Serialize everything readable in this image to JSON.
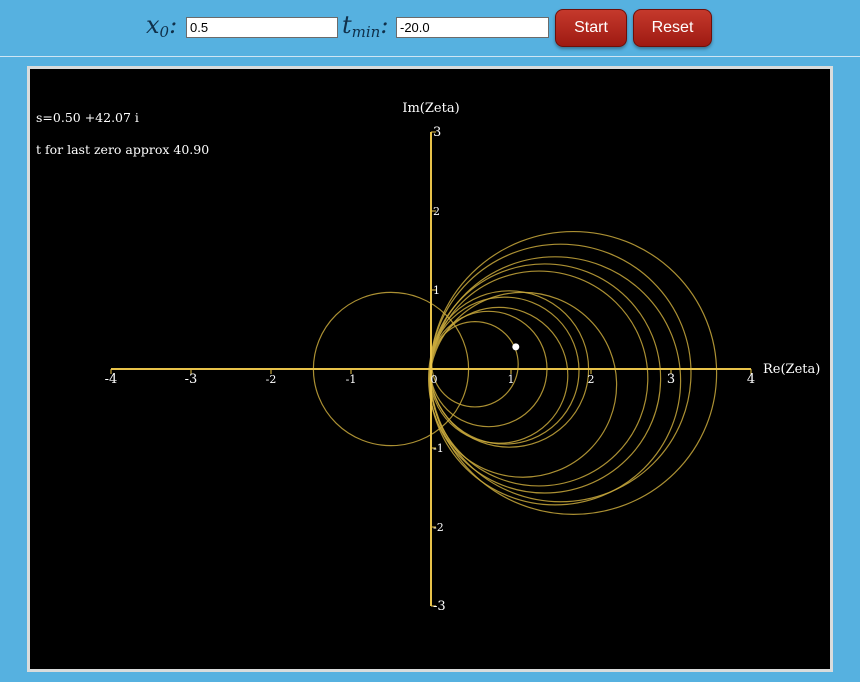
{
  "controls": {
    "x0_label": "x",
    "x0_sub": "0",
    "x0_value": "0.5",
    "tmin_label": "t",
    "tmin_sub": "min",
    "tmin_value": "-20.0",
    "start_label": "Start",
    "reset_label": "Reset"
  },
  "status": {
    "s_text": "s=0.50 +42.07 i",
    "zero_text": "t for last zero approx 40.90"
  },
  "colors": {
    "page_bg": "#56b1e0",
    "plot_bg": "#000000",
    "axis": "#e8c34a",
    "curve": "#c9a93c",
    "point": "#ffffff",
    "button": "#b22b1f"
  },
  "chart_data": {
    "type": "line",
    "title": "",
    "xlabel": "Re(Zeta)",
    "ylabel": "Im(Zeta)",
    "xlim": [
      -4,
      4
    ],
    "ylim": [
      -3,
      3
    ],
    "x_ticks": [
      -4,
      -3,
      -2,
      -1,
      0,
      1,
      2,
      3,
      4
    ],
    "y_ticks": [
      -3,
      -2,
      -1,
      0,
      1,
      2,
      3
    ],
    "x_tick_labels": [
      "-4",
      "-3",
      "-2",
      "-1",
      "0",
      "1",
      "2",
      "3",
      "4"
    ],
    "y_tick_labels": [
      "-3",
      "-2",
      "-1",
      "1",
      "2",
      "3"
    ],
    "grid": false,
    "series": [
      {
        "values": "loops of the image curve Re/Im of zeta(0.5 + i t) for t from -20.0 to 42.07, each loop passing through the origin",
        "loops": [
          {
            "center": [
              -0.5,
              0.0
            ],
            "radius": 0.97
          },
          {
            "center": [
              0.55,
              0.06
            ],
            "radius": 0.54
          },
          {
            "center": [
              0.72,
              0.0
            ],
            "radius": 0.73
          },
          {
            "center": [
              0.85,
              -0.08
            ],
            "radius": 0.86
          },
          {
            "center": [
              0.92,
              -0.02
            ],
            "radius": 0.93
          },
          {
            "center": [
              0.98,
              0.0
            ],
            "radius": 0.99
          },
          {
            "center": [
              1.15,
              -0.2
            ],
            "radius": 1.17
          },
          {
            "center": [
              1.35,
              -0.12
            ],
            "radius": 1.36
          },
          {
            "center": [
              1.42,
              -0.12
            ],
            "radius": 1.45
          },
          {
            "center": [
              1.55,
              -0.15
            ],
            "radius": 1.57
          },
          {
            "center": [
              1.62,
              -0.05
            ],
            "radius": 1.63
          },
          {
            "center": [
              1.78,
              -0.05
            ],
            "radius": 1.79
          }
        ]
      }
    ],
    "current_point": {
      "re": 1.06,
      "im": 0.28
    }
  }
}
